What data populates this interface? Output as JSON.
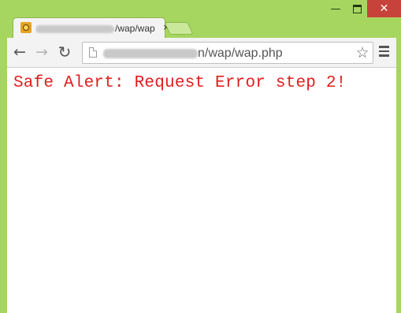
{
  "window": {
    "minimize_label": "—",
    "maximize_label": "",
    "close_label": "✕"
  },
  "tab": {
    "title_visible": "/wap/wap",
    "close_label": "×",
    "favicon": "site-favicon"
  },
  "toolbar": {
    "back_label": "←",
    "forward_label": "→",
    "reload_label": "↻",
    "url_visible": "n/wap/wap.php",
    "star_label": "☆"
  },
  "page": {
    "message": "Safe Alert: Request Error step 2!",
    "message_color": "#e11d1d"
  },
  "colors": {
    "frame": "#a7d660",
    "close_button": "#c7423a"
  }
}
